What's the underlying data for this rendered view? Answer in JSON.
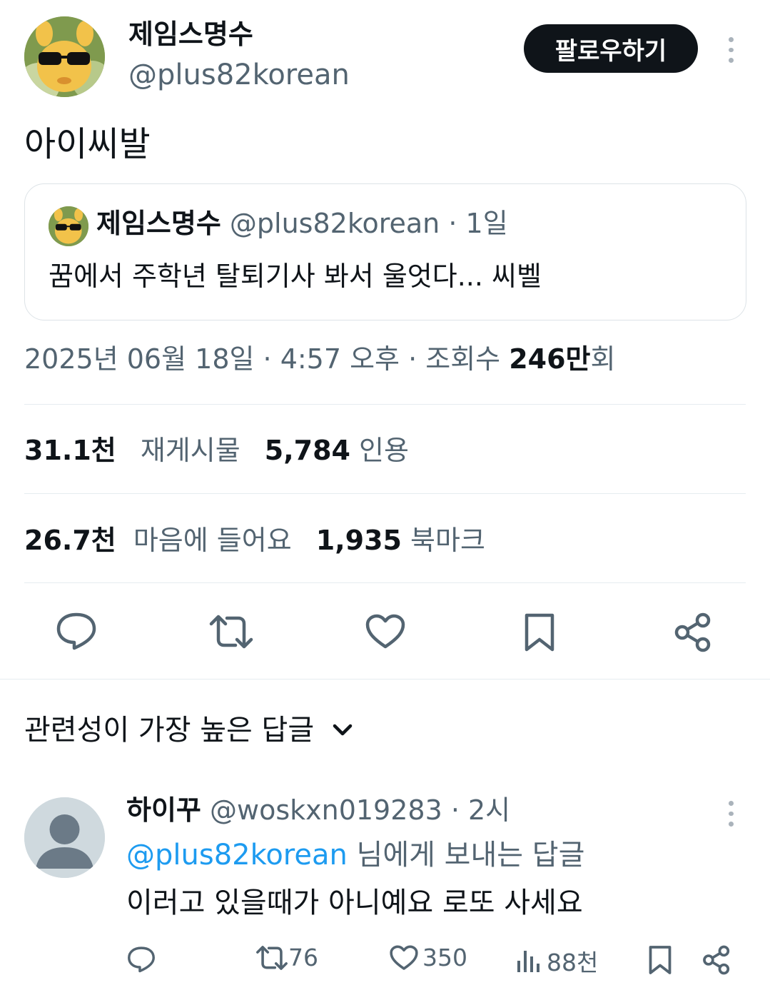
{
  "author": {
    "name": "제임스명수",
    "handle": "@plus82korean",
    "follow_label": "팔로우하기"
  },
  "tweet": {
    "text": "아이씨발",
    "quote": {
      "name": "제임스명수",
      "handle": "@plus82korean",
      "time": "· 1일",
      "text": "꿈에서 주학년 탈퇴기사 봐서 울엇다... 씨벨"
    },
    "meta": {
      "date": "2025년 06월 18일 · 4:57 오후 · 조회수 ",
      "views_num": "246만",
      "views_suffix": "회"
    },
    "stats": {
      "retweets_num": "31.1천",
      "retweets_label": "재게시물",
      "quotes_num": "5,784",
      "quotes_label": "인용",
      "likes_num": "26.7천",
      "likes_label": "마음에 들어요",
      "bookmarks_num": "1,935",
      "bookmarks_label": "북마크"
    }
  },
  "replies_header": {
    "label": "관련성이 가장 높은 답글"
  },
  "reply": {
    "name": "하이꾸",
    "handle": "@woskxn019283",
    "time": "· 2시",
    "mention": "@plus82korean",
    "mention_suffix": " 님에게 보내는 답글",
    "text": "이러고 있을때가 아니예요 로또 사세요",
    "retweets": "76",
    "likes": "350",
    "views": "88천"
  },
  "icons": {
    "reply": "reply-icon",
    "retweet": "retweet-icon",
    "like": "heart-icon",
    "bookmark": "bookmark-icon",
    "share": "share-icon",
    "views": "views-icon",
    "more": "more-icon",
    "chevron": "chevron-down-icon"
  }
}
